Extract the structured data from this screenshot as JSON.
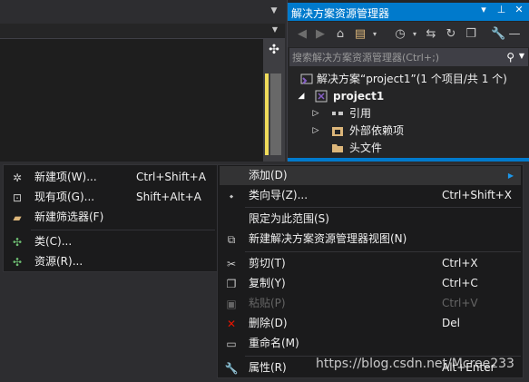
{
  "colors": {
    "accent": "#007acc",
    "menu_bg": "#1b1b1c",
    "highlight": "#333334",
    "delete_red": "#e51400",
    "folder_yellow": "#dcb67a",
    "vs_purple": "#865fc5"
  },
  "solution_explorer": {
    "title": "解决方案资源管理器",
    "title_buttons": [
      "▾",
      "⊥",
      "✕"
    ],
    "search_placeholder": "搜索解决方案资源管理器(Ctrl+;)",
    "tree": [
      {
        "label": "解决方案“project1”(1 个项目/共 1 个)",
        "icon": "solution-icon",
        "arrow": ""
      },
      {
        "label": "project1",
        "icon": "project-icon",
        "arrow": "◢"
      },
      {
        "label": "引用",
        "icon": "references-icon",
        "arrow": "▷"
      },
      {
        "label": "外部依赖项",
        "icon": "external-deps-icon",
        "arrow": "▷"
      },
      {
        "label": "头文件",
        "icon": "folder-icon",
        "arrow": ""
      }
    ]
  },
  "context_menu": {
    "items": [
      {
        "label": "添加(D)",
        "shortcut": "",
        "icon": "",
        "submenu": true
      },
      {
        "label": "类向导(Z)...",
        "shortcut": "Ctrl+Shift+X",
        "icon": "class-wizard-icon"
      },
      {
        "label": "限定为此范围(S)",
        "shortcut": "",
        "icon": ""
      },
      {
        "label": "新建解决方案资源管理器视图(N)",
        "shortcut": "",
        "icon": "new-view-icon"
      },
      {
        "label": "剪切(T)",
        "shortcut": "Ctrl+X",
        "icon": "scissors-icon"
      },
      {
        "label": "复制(Y)",
        "shortcut": "Ctrl+C",
        "icon": "copy-icon"
      },
      {
        "label": "粘贴(P)",
        "shortcut": "Ctrl+V",
        "icon": "paste-icon"
      },
      {
        "label": "删除(D)",
        "shortcut": "Del",
        "icon": "delete-icon"
      },
      {
        "label": "重命名(M)",
        "shortcut": "",
        "icon": "rename-icon"
      },
      {
        "label": "属性(R)",
        "shortcut": "Alt+Enter",
        "icon": "wrench-icon"
      }
    ]
  },
  "submenu": {
    "items": [
      {
        "label": "新建项(W)...",
        "shortcut": "Ctrl+Shift+A",
        "icon": "new-item-icon"
      },
      {
        "label": "现有项(G)...",
        "shortcut": "Shift+Alt+A",
        "icon": "existing-item-icon"
      },
      {
        "label": "新建筛选器(F)",
        "shortcut": "",
        "icon": "new-filter-icon"
      },
      {
        "label": "类(C)...",
        "shortcut": "",
        "icon": "class-icon"
      },
      {
        "label": "资源(R)...",
        "shortcut": "",
        "icon": "resource-icon"
      }
    ]
  },
  "watermark": "https://blog.csdn.net/Mcree233"
}
